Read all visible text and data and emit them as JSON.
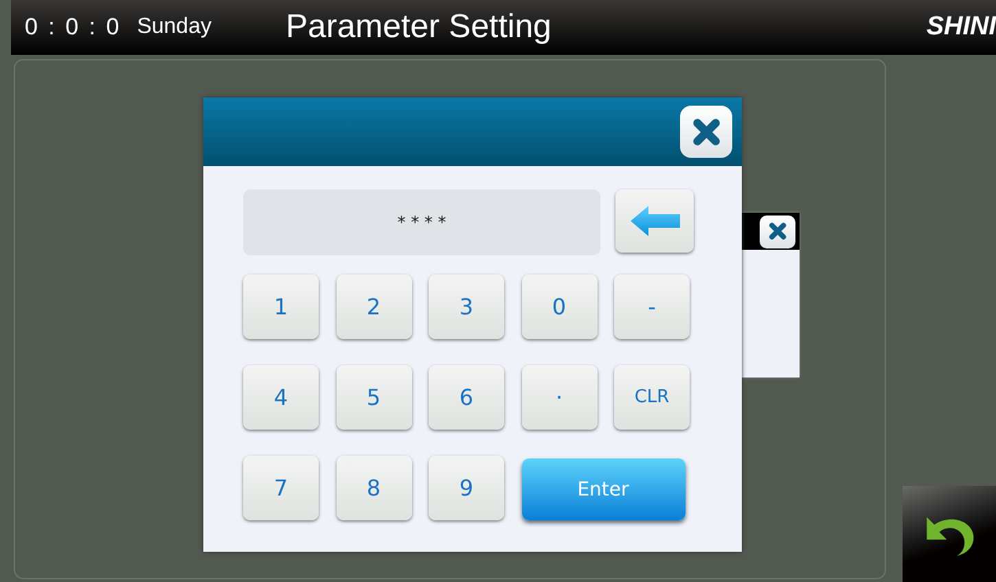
{
  "status_bar": {
    "time": "0 : 0 : 0",
    "day": "Sunday",
    "title": "Parameter Setting",
    "logo": "SHINI"
  },
  "keypad": {
    "display": "* * * *",
    "keys": [
      {
        "label": "1",
        "kind": "key"
      },
      {
        "label": "2",
        "kind": "key"
      },
      {
        "label": "3",
        "kind": "key"
      },
      {
        "label": "0",
        "kind": "key"
      },
      {
        "label": "-",
        "kind": "key"
      },
      {
        "label": "4",
        "kind": "key"
      },
      {
        "label": "5",
        "kind": "key"
      },
      {
        "label": "6",
        "kind": "key"
      },
      {
        "label": "·",
        "kind": "key"
      },
      {
        "label": "CLR",
        "kind": "small"
      },
      {
        "label": "7",
        "kind": "key"
      },
      {
        "label": "8",
        "kind": "key"
      },
      {
        "label": "9",
        "kind": "key"
      },
      {
        "label": "Enter",
        "kind": "enter"
      }
    ]
  }
}
